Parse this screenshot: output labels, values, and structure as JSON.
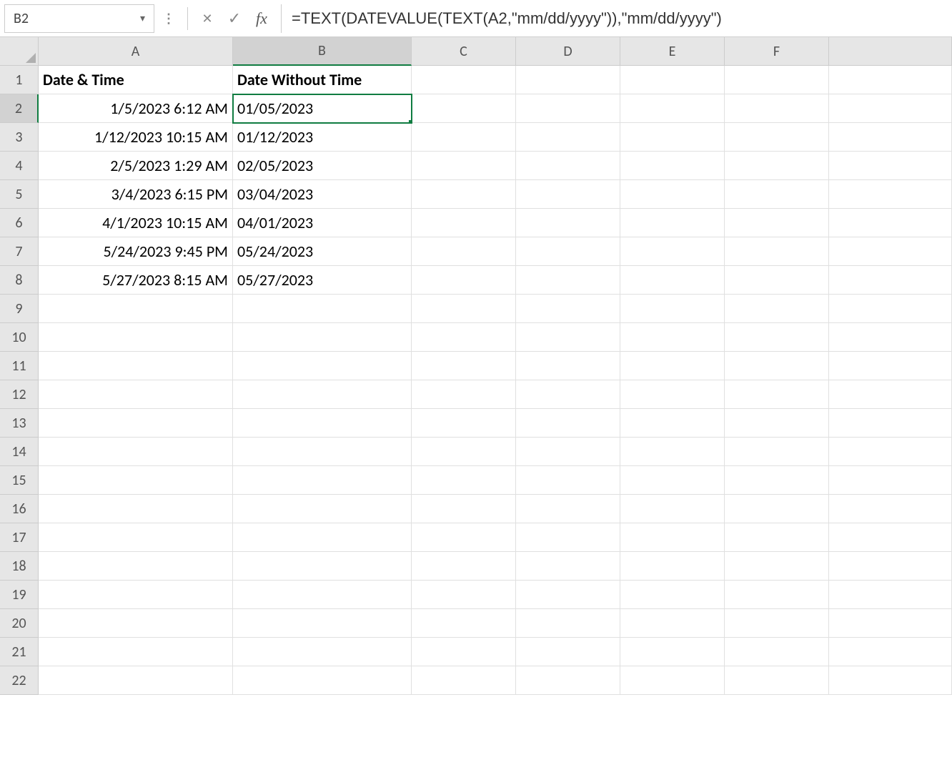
{
  "nameBox": "B2",
  "formula": "=TEXT(DATEVALUE(TEXT(A2,\"mm/dd/yyyy\")),\"mm/dd/yyyy\")",
  "columnHeaders": [
    "A",
    "B",
    "C",
    "D",
    "E",
    "F"
  ],
  "rowHeaders": [
    "1",
    "2",
    "3",
    "4",
    "5",
    "6",
    "7",
    "8",
    "9",
    "10",
    "11",
    "12",
    "13",
    "14",
    "15",
    "16",
    "17",
    "18",
    "19",
    "20",
    "21",
    "22"
  ],
  "selectedCol": 1,
  "selectedRow": 1,
  "headerRow": {
    "A": "Date & Time",
    "B": "Date Without Time"
  },
  "dataRows": [
    {
      "A": "1/5/2023 6:12 AM",
      "B": "01/05/2023"
    },
    {
      "A": "1/12/2023 10:15 AM",
      "B": "01/12/2023"
    },
    {
      "A": "2/5/2023 1:29 AM",
      "B": "02/05/2023"
    },
    {
      "A": "3/4/2023 6:15 PM",
      "B": "03/04/2023"
    },
    {
      "A": "4/1/2023 10:15 AM",
      "B": "04/01/2023"
    },
    {
      "A": "5/24/2023 9:45 PM",
      "B": "05/24/2023"
    },
    {
      "A": "5/27/2023 8:15 AM",
      "B": "05/27/2023"
    }
  ]
}
